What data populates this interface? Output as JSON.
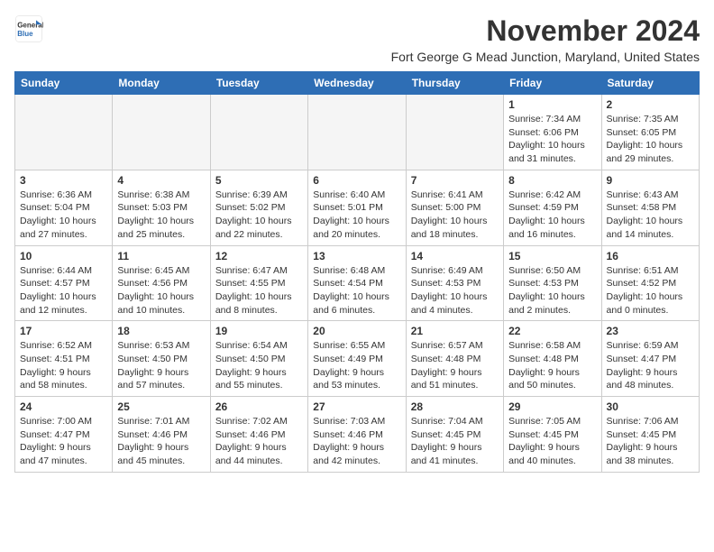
{
  "header": {
    "logo": {
      "general": "General",
      "blue": "Blue"
    },
    "title": "November 2024",
    "location": "Fort George G Mead Junction, Maryland, United States"
  },
  "calendar": {
    "days_of_week": [
      "Sunday",
      "Monday",
      "Tuesday",
      "Wednesday",
      "Thursday",
      "Friday",
      "Saturday"
    ],
    "weeks": [
      {
        "days": [
          {
            "num": "",
            "info": ""
          },
          {
            "num": "",
            "info": ""
          },
          {
            "num": "",
            "info": ""
          },
          {
            "num": "",
            "info": ""
          },
          {
            "num": "",
            "info": ""
          },
          {
            "num": "1",
            "info": "Sunrise: 7:34 AM\nSunset: 6:06 PM\nDaylight: 10 hours\nand 31 minutes."
          },
          {
            "num": "2",
            "info": "Sunrise: 7:35 AM\nSunset: 6:05 PM\nDaylight: 10 hours\nand 29 minutes."
          }
        ]
      },
      {
        "days": [
          {
            "num": "3",
            "info": "Sunrise: 6:36 AM\nSunset: 5:04 PM\nDaylight: 10 hours\nand 27 minutes."
          },
          {
            "num": "4",
            "info": "Sunrise: 6:38 AM\nSunset: 5:03 PM\nDaylight: 10 hours\nand 25 minutes."
          },
          {
            "num": "5",
            "info": "Sunrise: 6:39 AM\nSunset: 5:02 PM\nDaylight: 10 hours\nand 22 minutes."
          },
          {
            "num": "6",
            "info": "Sunrise: 6:40 AM\nSunset: 5:01 PM\nDaylight: 10 hours\nand 20 minutes."
          },
          {
            "num": "7",
            "info": "Sunrise: 6:41 AM\nSunset: 5:00 PM\nDaylight: 10 hours\nand 18 minutes."
          },
          {
            "num": "8",
            "info": "Sunrise: 6:42 AM\nSunset: 4:59 PM\nDaylight: 10 hours\nand 16 minutes."
          },
          {
            "num": "9",
            "info": "Sunrise: 6:43 AM\nSunset: 4:58 PM\nDaylight: 10 hours\nand 14 minutes."
          }
        ]
      },
      {
        "days": [
          {
            "num": "10",
            "info": "Sunrise: 6:44 AM\nSunset: 4:57 PM\nDaylight: 10 hours\nand 12 minutes."
          },
          {
            "num": "11",
            "info": "Sunrise: 6:45 AM\nSunset: 4:56 PM\nDaylight: 10 hours\nand 10 minutes."
          },
          {
            "num": "12",
            "info": "Sunrise: 6:47 AM\nSunset: 4:55 PM\nDaylight: 10 hours\nand 8 minutes."
          },
          {
            "num": "13",
            "info": "Sunrise: 6:48 AM\nSunset: 4:54 PM\nDaylight: 10 hours\nand 6 minutes."
          },
          {
            "num": "14",
            "info": "Sunrise: 6:49 AM\nSunset: 4:53 PM\nDaylight: 10 hours\nand 4 minutes."
          },
          {
            "num": "15",
            "info": "Sunrise: 6:50 AM\nSunset: 4:53 PM\nDaylight: 10 hours\nand 2 minutes."
          },
          {
            "num": "16",
            "info": "Sunrise: 6:51 AM\nSunset: 4:52 PM\nDaylight: 10 hours\nand 0 minutes."
          }
        ]
      },
      {
        "days": [
          {
            "num": "17",
            "info": "Sunrise: 6:52 AM\nSunset: 4:51 PM\nDaylight: 9 hours\nand 58 minutes."
          },
          {
            "num": "18",
            "info": "Sunrise: 6:53 AM\nSunset: 4:50 PM\nDaylight: 9 hours\nand 57 minutes."
          },
          {
            "num": "19",
            "info": "Sunrise: 6:54 AM\nSunset: 4:50 PM\nDaylight: 9 hours\nand 55 minutes."
          },
          {
            "num": "20",
            "info": "Sunrise: 6:55 AM\nSunset: 4:49 PM\nDaylight: 9 hours\nand 53 minutes."
          },
          {
            "num": "21",
            "info": "Sunrise: 6:57 AM\nSunset: 4:48 PM\nDaylight: 9 hours\nand 51 minutes."
          },
          {
            "num": "22",
            "info": "Sunrise: 6:58 AM\nSunset: 4:48 PM\nDaylight: 9 hours\nand 50 minutes."
          },
          {
            "num": "23",
            "info": "Sunrise: 6:59 AM\nSunset: 4:47 PM\nDaylight: 9 hours\nand 48 minutes."
          }
        ]
      },
      {
        "days": [
          {
            "num": "24",
            "info": "Sunrise: 7:00 AM\nSunset: 4:47 PM\nDaylight: 9 hours\nand 47 minutes."
          },
          {
            "num": "25",
            "info": "Sunrise: 7:01 AM\nSunset: 4:46 PM\nDaylight: 9 hours\nand 45 minutes."
          },
          {
            "num": "26",
            "info": "Sunrise: 7:02 AM\nSunset: 4:46 PM\nDaylight: 9 hours\nand 44 minutes."
          },
          {
            "num": "27",
            "info": "Sunrise: 7:03 AM\nSunset: 4:46 PM\nDaylight: 9 hours\nand 42 minutes."
          },
          {
            "num": "28",
            "info": "Sunrise: 7:04 AM\nSunset: 4:45 PM\nDaylight: 9 hours\nand 41 minutes."
          },
          {
            "num": "29",
            "info": "Sunrise: 7:05 AM\nSunset: 4:45 PM\nDaylight: 9 hours\nand 40 minutes."
          },
          {
            "num": "30",
            "info": "Sunrise: 7:06 AM\nSunset: 4:45 PM\nDaylight: 9 hours\nand 38 minutes."
          }
        ]
      }
    ]
  }
}
